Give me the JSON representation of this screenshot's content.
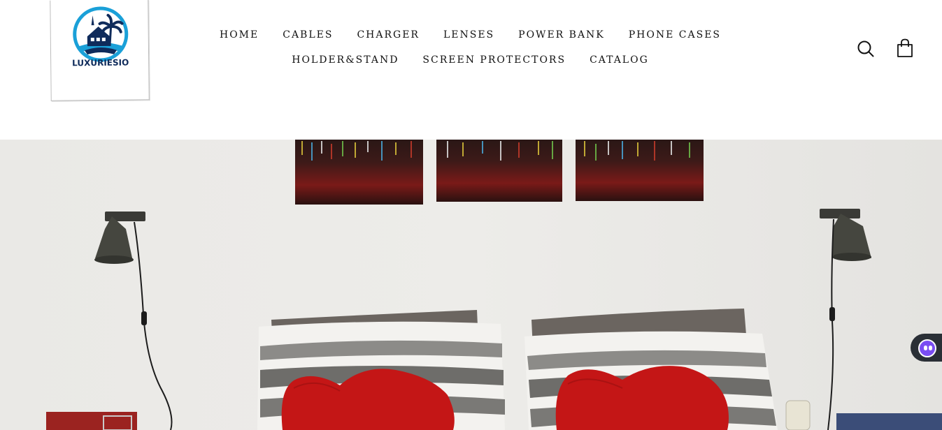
{
  "brand": {
    "name": "LUXURIESIO"
  },
  "nav": {
    "row1": [
      {
        "label": "HOME"
      },
      {
        "label": "CABLES"
      },
      {
        "label": "CHARGER"
      },
      {
        "label": "LENSES"
      },
      {
        "label": "POWER BANK"
      },
      {
        "label": "PHONE CASES"
      }
    ],
    "row2": [
      {
        "label": "HOLDER&STAND"
      },
      {
        "label": "SCREEN PROTECTORS"
      },
      {
        "label": "CATALOG"
      }
    ]
  },
  "header_icons": {
    "search": "search-icon",
    "cart": "cart-icon"
  },
  "hero": {
    "image": "bedroom-scene-with-heart-pillows"
  },
  "chat": {
    "icon": "chatbot-face-icon",
    "accent": "#7a4df2"
  },
  "colors": {
    "background": "#ffffff",
    "text": "#111111",
    "logo_blue": "#1aa0d8",
    "logo_navy": "#0f2b5b"
  }
}
